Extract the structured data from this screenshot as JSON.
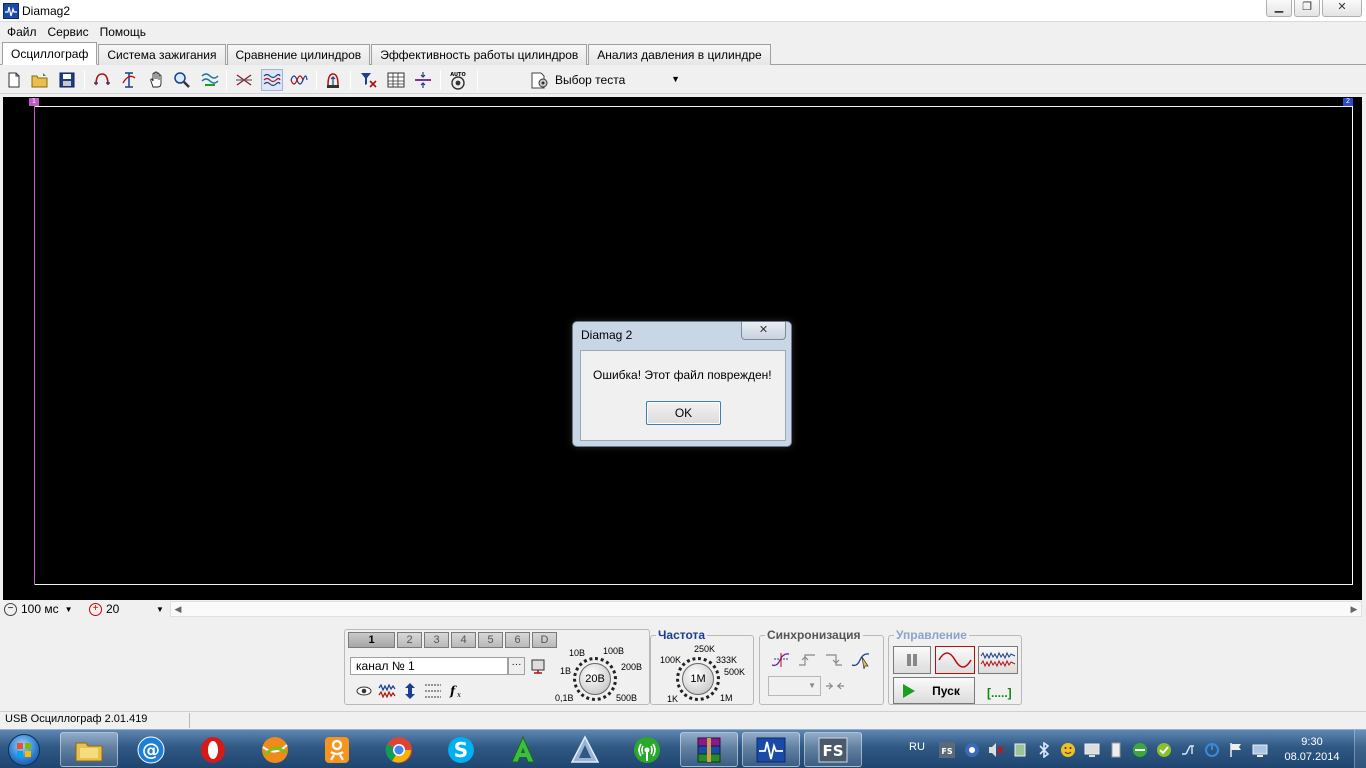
{
  "window": {
    "title": "Diamag2"
  },
  "menu": {
    "items": [
      "Файл",
      "Сервис",
      "Помощь"
    ]
  },
  "tabs": [
    {
      "label": "Осциллограф",
      "active": true
    },
    {
      "label": "Система зажигания"
    },
    {
      "label": "Сравнение цилиндров"
    },
    {
      "label": "Эффективность работы цилиндров"
    },
    {
      "label": "Анализ давления в цилиндре"
    }
  ],
  "toolbar": {
    "test_select": "Выбор теста",
    "auto_label": "AUTO"
  },
  "scope": {
    "marker_left": "1",
    "marker_right": "2"
  },
  "time_scale": {
    "value": "100 мс"
  },
  "amp_scale": {
    "value": "20"
  },
  "channels": {
    "buttons": [
      "1",
      "2",
      "3",
      "4",
      "5",
      "6",
      "D"
    ],
    "active": "1",
    "name": "канал № 1",
    "browse": "···"
  },
  "voltage_knob": {
    "value": "20В",
    "labels": [
      "10В",
      "100В",
      "1В",
      "200В",
      "0,1В",
      "500В"
    ]
  },
  "frequency": {
    "title": "Частота",
    "value": "1M",
    "labels": [
      "250K",
      "100K",
      "333K",
      "500K",
      "1K",
      "1M"
    ]
  },
  "sync": {
    "title": "Синхронизация"
  },
  "control": {
    "title": "Управление",
    "start_label": "Пуск",
    "status": "[.....]"
  },
  "statusbar": {
    "text": "USB Осциллограф  2.01.419"
  },
  "dialog": {
    "title": "Diamag 2",
    "message": "Ошибка! Этот файл поврежден!",
    "ok_label": "OK",
    "close_glyph": "✕"
  },
  "taskbar": {
    "lang": "RU",
    "time": "9:30",
    "date": "08.07.2014",
    "apps": [
      "explorer",
      "mail-ru",
      "opera",
      "tennis-game",
      "odnoklassniki",
      "chrome",
      "skype",
      "a-app",
      "triangle-app",
      "wireless-app",
      "winrar",
      "diamag2",
      "fs-app"
    ],
    "tray_fs": "FS",
    "fs_label": "FS"
  },
  "colors": {
    "scope_bg": "#000000",
    "left_edge": "#c05cc8",
    "knob_accent": "#1a3f8e",
    "start_green": "#1aa01a",
    "taskbar": "#2f5883"
  }
}
